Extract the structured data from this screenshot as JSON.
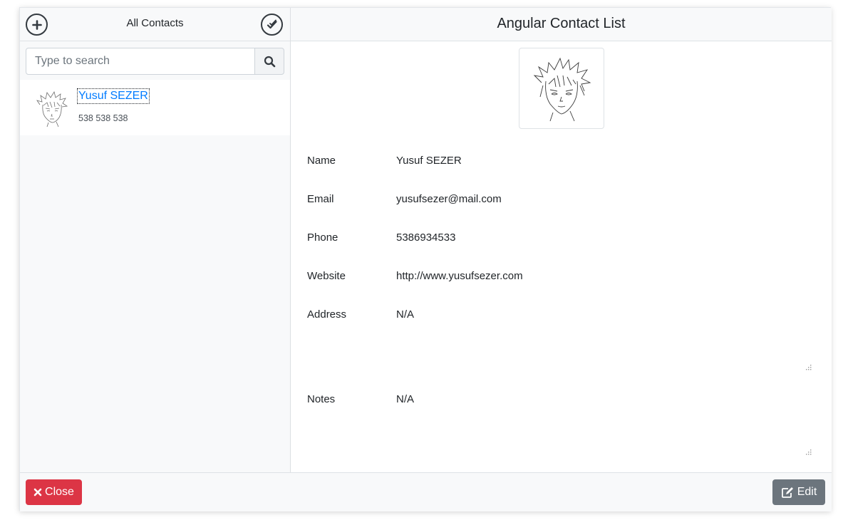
{
  "sidebar": {
    "title": "All Contacts",
    "add_icon": "plus-circle-icon",
    "select_icon": "double-check-icon",
    "search": {
      "placeholder": "Type to search",
      "value": "",
      "icon": "search-icon"
    },
    "contacts": [
      {
        "name": "Yusuf SEZER",
        "phone": "538 538 538",
        "avatar": "anime-sketch-avatar"
      }
    ]
  },
  "main": {
    "title": "Angular Contact List",
    "photo": "anime-sketch-portrait",
    "fields": [
      {
        "label": "Name",
        "value": "Yusuf SEZER"
      },
      {
        "label": "Email",
        "value": "yusufsezer@mail.com"
      },
      {
        "label": "Phone",
        "value": "5386934533"
      },
      {
        "label": "Website",
        "value": "http://www.yusufsezer.com"
      },
      {
        "label": "Address",
        "value": "N/A"
      },
      {
        "label": "Notes",
        "value": "N/A"
      }
    ]
  },
  "footer": {
    "close_label": "Close",
    "close_icon": "times-icon",
    "edit_label": "Edit",
    "edit_icon": "edit-icon"
  },
  "colors": {
    "link": "#007bff",
    "danger": "#dc3545",
    "secondary": "#6c757d",
    "panel": "#f8f9fa"
  }
}
